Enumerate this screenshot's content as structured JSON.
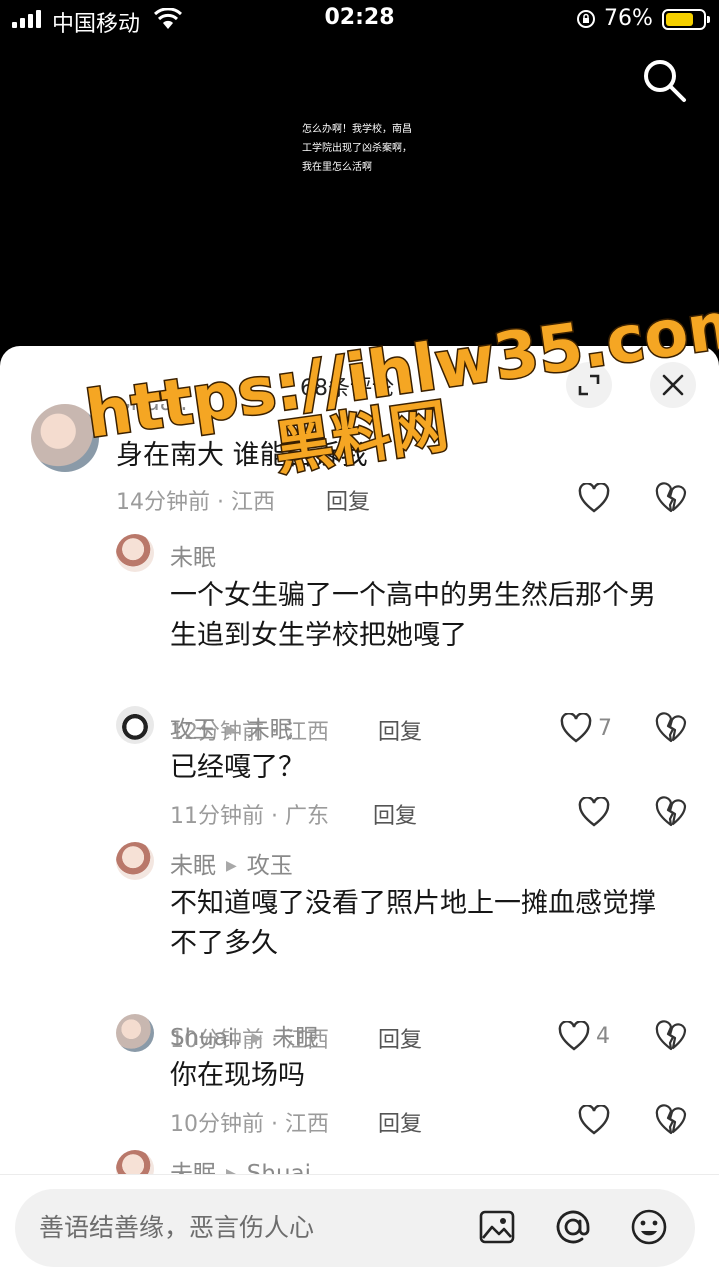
{
  "status_bar": {
    "carrier": "中国移动",
    "time": "02:28",
    "battery": "76%"
  },
  "video": {
    "caption": "怎么办啊！我学校，南昌工学院出现了凶杀案啊，我在里怎么活啊"
  },
  "sheet": {
    "title": "68条评论"
  },
  "comments": [
    {
      "author": "Shuai.",
      "text": "身在南大 谁能告诉我",
      "time_location": "14分钟前 · 江西",
      "reply_label": "回复",
      "likes": ""
    },
    {
      "author": "未眠",
      "text": "一个女生骗了一个高中的男生然后那个男生追到女生学校把她嘎了",
      "time_location": "12分钟前 · 江西",
      "reply_label": "回复",
      "likes": "7"
    },
    {
      "author": "攻玉",
      "reply_to": "未眠",
      "text": "已经嘎了？",
      "time_location": "11分钟前 · 广东",
      "reply_label": "回复",
      "likes": ""
    },
    {
      "author": "未眠",
      "reply_to": "攻玉",
      "text": "不知道嘎了没看了照片地上一摊血感觉撑不了多久",
      "time_location": "10分钟前 · 江西",
      "reply_label": "回复",
      "likes": "4"
    },
    {
      "author": "Shuai.",
      "reply_to": "未眠",
      "text": "你在现场吗",
      "time_location": "10分钟前 · 江西",
      "reply_label": "回复",
      "likes": ""
    },
    {
      "author": "未眠",
      "reply_to": "Shuai."
    }
  ],
  "input": {
    "placeholder": "善语结善缘，恶言伤人心"
  },
  "watermark": {
    "line1": "https://ihlw35.com",
    "line2": "黑料网"
  },
  "colors": {
    "watermark_fill": "#f5a623",
    "battery": "#f5d000"
  }
}
